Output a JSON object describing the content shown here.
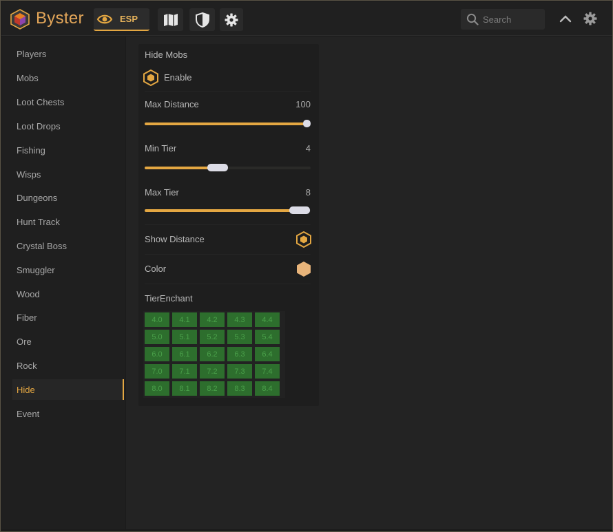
{
  "app": {
    "name": "Byster"
  },
  "tabs": [
    {
      "label": "ESP",
      "icon": "eye-icon"
    },
    {
      "label": "",
      "icon": "map-icon"
    },
    {
      "label": "",
      "icon": "shield-icon"
    },
    {
      "label": "",
      "icon": "gear-icon"
    }
  ],
  "search": {
    "placeholder": "Search",
    "value": ""
  },
  "sidebar": {
    "items": [
      {
        "label": "Players"
      },
      {
        "label": "Mobs"
      },
      {
        "label": "Loot Chests"
      },
      {
        "label": "Loot Drops"
      },
      {
        "label": "Fishing"
      },
      {
        "label": "Wisps"
      },
      {
        "label": "Dungeons"
      },
      {
        "label": "Hunt Track"
      },
      {
        "label": "Crystal Boss"
      },
      {
        "label": "Smuggler"
      },
      {
        "label": "Wood"
      },
      {
        "label": "Fiber"
      },
      {
        "label": "Ore"
      },
      {
        "label": "Rock"
      },
      {
        "label": "Hide"
      },
      {
        "label": "Event"
      }
    ],
    "active": "Hide"
  },
  "panel": {
    "title": "Hide Mobs",
    "enable": {
      "label": "Enable",
      "checked": true
    },
    "max_distance": {
      "label": "Max Distance",
      "value": "100",
      "fill_fraction": 1.0
    },
    "min_tier": {
      "label": "Min Tier",
      "value": "4",
      "fill_fraction": 0.44
    },
    "max_tier": {
      "label": "Max Tier",
      "value": "8",
      "fill_fraction": 0.93
    },
    "show_distance": {
      "label": "Show Distance",
      "checked": true
    },
    "color": {
      "label": "Color",
      "swatch": "#e8b47a"
    },
    "tier_enchant": {
      "label": "TierEnchant",
      "rows": [
        [
          "4.0",
          "4.1",
          "4.2",
          "4.3",
          "4.4"
        ],
        [
          "5.0",
          "5.1",
          "5.2",
          "5.3",
          "5.4"
        ],
        [
          "6.0",
          "6.1",
          "6.2",
          "6.3",
          "6.4"
        ],
        [
          "7.0",
          "7.1",
          "7.2",
          "7.3",
          "7.4"
        ],
        [
          "8.0",
          "8.1",
          "8.2",
          "8.3",
          "8.4"
        ]
      ]
    }
  },
  "colors": {
    "accent": "#e4a742",
    "brand": "#e3a659",
    "cell_bg": "#2d6e2d",
    "cell_text": "#4aa14a"
  }
}
